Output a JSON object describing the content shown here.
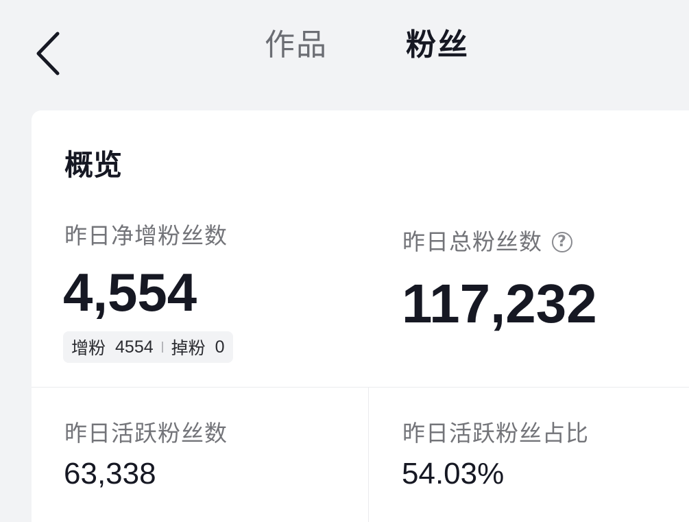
{
  "header": {
    "back_icon": "chevron-left-icon",
    "tabs": [
      {
        "label": "作品",
        "active": false
      },
      {
        "label": "粉丝",
        "active": true
      }
    ]
  },
  "overview": {
    "title": "概览",
    "net_new_fans": {
      "label": "昨日净增粉丝数",
      "value": "4,554",
      "gain_label": "增粉",
      "gain_value": "4554",
      "loss_label": "掉粉",
      "loss_value": "0"
    },
    "total_fans": {
      "label": "昨日总粉丝数",
      "help_icon": "question-circle-icon",
      "value": "117,232"
    },
    "active_fans": {
      "label": "昨日活跃粉丝数",
      "value": "63,338"
    },
    "active_ratio": {
      "label": "昨日活跃粉丝占比",
      "value": "54.03%"
    }
  },
  "colors": {
    "background": "#f2f3f5",
    "card": "#ffffff",
    "text_primary": "#161823",
    "text_secondary": "#737479"
  }
}
